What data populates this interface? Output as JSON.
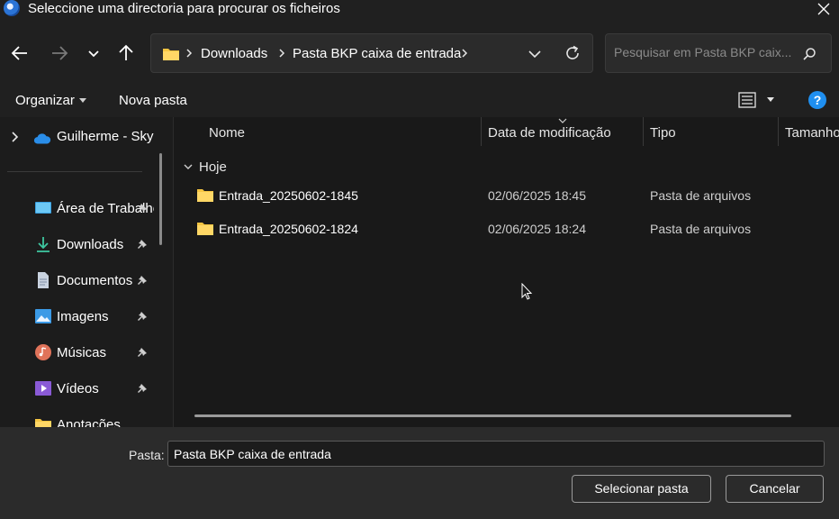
{
  "window": {
    "title": "Seleccione uma directoria para procurar os ficheiros"
  },
  "address": {
    "crumbs": [
      "Downloads",
      "Pasta BKP caixa de entrada"
    ]
  },
  "search": {
    "placeholder": "Pesquisar em Pasta BKP caix..."
  },
  "commands": {
    "organize": "Organizar",
    "new_folder": "Nova pasta",
    "help": "?"
  },
  "navpane": {
    "cloud": "Guilherme - Skype",
    "items": [
      {
        "label": "Área de Trabalho",
        "icon": "desktop-icon"
      },
      {
        "label": "Downloads",
        "icon": "download-icon"
      },
      {
        "label": "Documentos",
        "icon": "documents-icon"
      },
      {
        "label": "Imagens",
        "icon": "pictures-icon"
      },
      {
        "label": "Músicas",
        "icon": "music-icon"
      },
      {
        "label": "Vídeos",
        "icon": "videos-icon"
      },
      {
        "label": "Anotações",
        "icon": "folder-icon"
      }
    ]
  },
  "filelist": {
    "columns": {
      "name": "Nome",
      "date": "Data de modificação",
      "type": "Tipo",
      "size": "Tamanho"
    },
    "group": "Hoje",
    "rows": [
      {
        "name": "Entrada_20250602-1845",
        "date": "02/06/2025 18:45",
        "type": "Pasta de arquivos"
      },
      {
        "name": "Entrada_20250602-1824",
        "date": "02/06/2025 18:24",
        "type": "Pasta de arquivos"
      }
    ]
  },
  "footer": {
    "folder_label": "Pasta:",
    "folder_value": "Pasta BKP caixa de entrada",
    "select_button": "Selecionar pasta",
    "cancel_button": "Cancelar"
  },
  "colors": {
    "accent": "#1f8ff0",
    "folder": "#f5c542",
    "background": "#1c1c1c"
  }
}
